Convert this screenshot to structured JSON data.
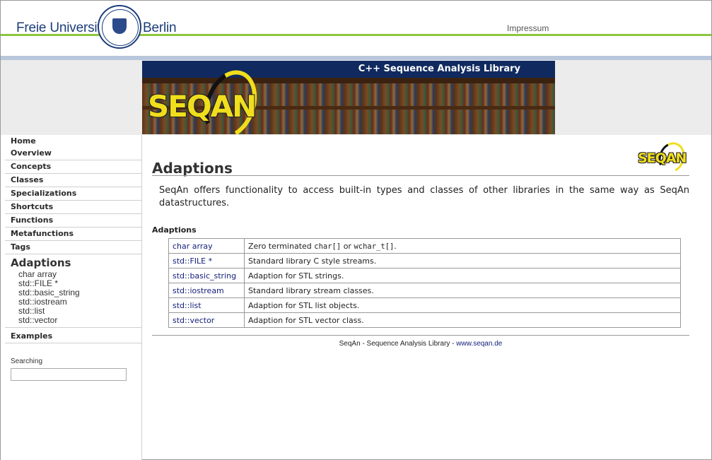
{
  "header": {
    "university_left": "Freie Universität",
    "university_right": "Berlin",
    "impressum": "Impressum"
  },
  "banner": {
    "title": "C++ Sequence Analysis Library",
    "logo_text": "SEQAN"
  },
  "sidebar": {
    "items": [
      {
        "label": "Home"
      },
      {
        "label": "Overview"
      },
      {
        "label": "Concepts"
      },
      {
        "label": "Classes"
      },
      {
        "label": "Specializations"
      },
      {
        "label": "Shortcuts"
      },
      {
        "label": "Functions"
      },
      {
        "label": "Metafunctions"
      },
      {
        "label": "Tags"
      }
    ],
    "section": {
      "title": "Adaptions",
      "subitems": [
        "char array",
        "std::FILE *",
        "std::basic_string",
        "std::iostream",
        "std::list",
        "std::vector"
      ]
    },
    "examples": "Examples",
    "search_label": "Searching",
    "search_value": ""
  },
  "main": {
    "logo_text": "SEQAN",
    "title": "Adaptions",
    "intro": "SeqAn offers functionality to access built-in types and classes of other libraries in the same way as SeqAn datastructures.",
    "section_heading": "Adaptions",
    "rows": [
      {
        "name": "char array",
        "desc_pre": "Zero terminated ",
        "code1": "char[]",
        "mid": " or ",
        "code2": "wchar_t[]",
        "desc_post": "."
      },
      {
        "name": "std::FILE *",
        "desc": "Standard library C style streams."
      },
      {
        "name": "std::basic_string",
        "desc": "Adaption for STL strings."
      },
      {
        "name": "std::iostream",
        "desc": "Standard library stream classes."
      },
      {
        "name": "std::list",
        "desc": "Adaption for STL list objects."
      },
      {
        "name": "std::vector",
        "desc": "Adaption for STL vector class."
      }
    ],
    "footer_text": "SeqAn - Sequence Analysis Library - ",
    "footer_link": "www.seqan.de"
  },
  "colors": {
    "fu_blue": "#1c3d7a",
    "fu_green": "#8cc63f",
    "banner_navy": "#102a5f",
    "seqan_yellow": "#f0de1c",
    "link_blue": "#15207a"
  }
}
